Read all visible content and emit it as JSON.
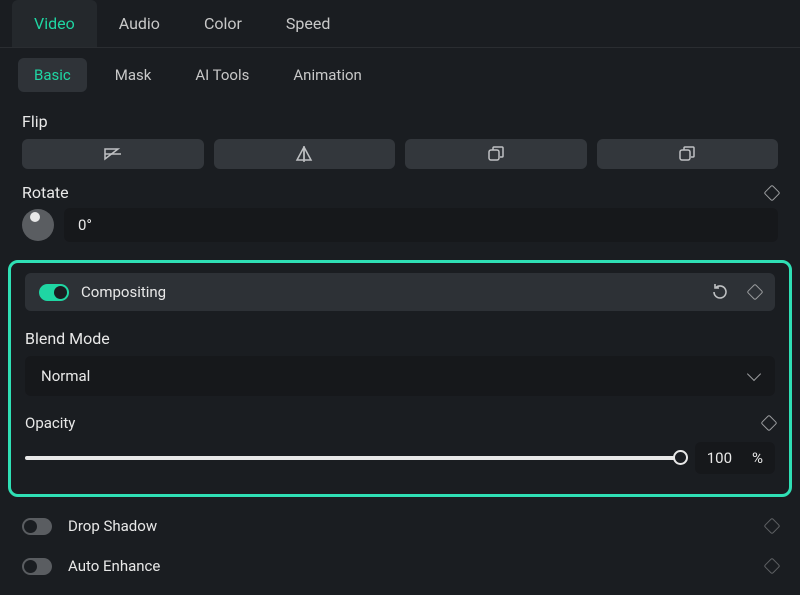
{
  "mainTabs": {
    "video": "Video",
    "audio": "Audio",
    "color": "Color",
    "speed": "Speed"
  },
  "subTabs": {
    "basic": "Basic",
    "mask": "Mask",
    "aiTools": "AI Tools",
    "animation": "Animation"
  },
  "flip": {
    "label": "Flip"
  },
  "rotate": {
    "label": "Rotate",
    "value": "0°"
  },
  "compositing": {
    "label": "Compositing",
    "blendMode": {
      "label": "Blend Mode",
      "value": "Normal"
    },
    "opacity": {
      "label": "Opacity",
      "value": "100",
      "unit": "%"
    }
  },
  "dropShadow": {
    "label": "Drop Shadow"
  },
  "autoEnhance": {
    "label": "Auto Enhance"
  }
}
